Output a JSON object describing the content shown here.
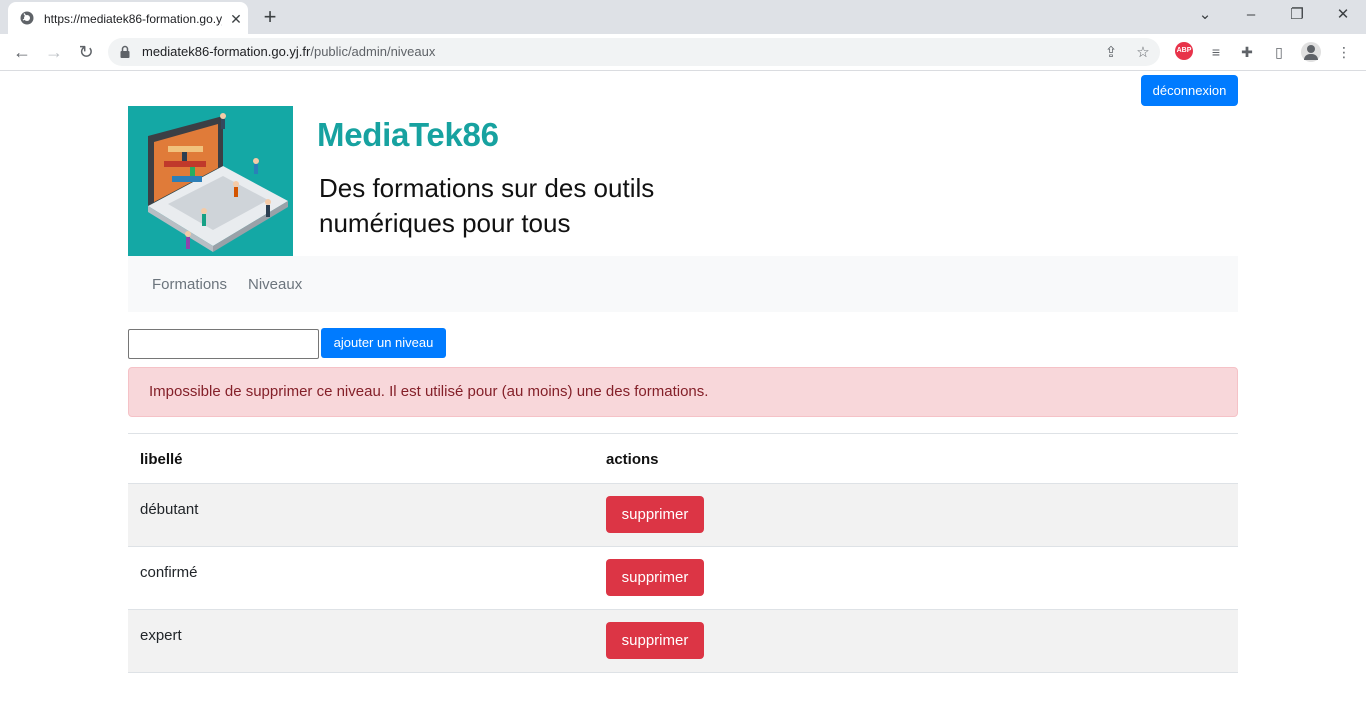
{
  "browser": {
    "tab_title": "https://mediatek86-formation.go.yj.fr/public/admin/niveaux",
    "url_host": "mediatek86-formation.go.yj.fr",
    "url_path": "/public/admin/niveaux",
    "abp_label": "ABP"
  },
  "header": {
    "logout_label": "déconnexion",
    "site_title": "MediaTek86",
    "tagline_line1": "Des formations sur des outils",
    "tagline_line2": "numériques pour tous"
  },
  "nav": {
    "items": [
      {
        "label": "Formations"
      },
      {
        "label": "Niveaux"
      }
    ]
  },
  "form": {
    "input_value": "",
    "add_label": "ajouter un niveau"
  },
  "alert": {
    "message": "Impossible de supprimer ce niveau. Il est utilisé pour (au moins) une des formations."
  },
  "table": {
    "headers": [
      "libellé",
      "actions"
    ],
    "rows": [
      {
        "label": "débutant",
        "action": "supprimer"
      },
      {
        "label": "confirmé",
        "action": "supprimer"
      },
      {
        "label": "expert",
        "action": "supprimer"
      }
    ]
  },
  "colors": {
    "primary": "#007bff",
    "danger": "#dc3545",
    "brand_teal": "#17a2a0",
    "alert_bg": "#f8d7da",
    "alert_text": "#842029"
  }
}
